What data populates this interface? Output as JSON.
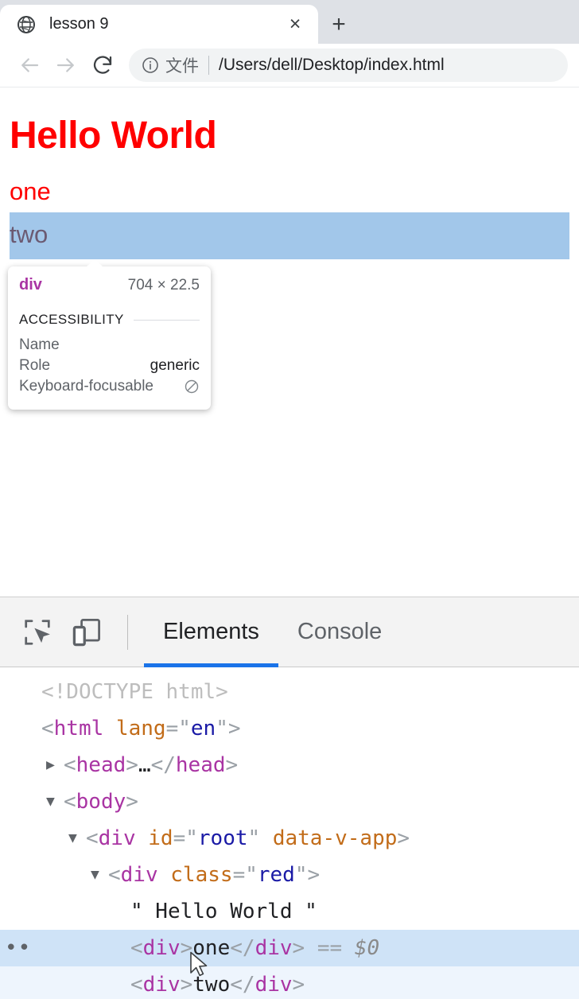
{
  "browser": {
    "tab": {
      "title": "lesson 9",
      "favicon": "globe-icon",
      "close_label": "×"
    },
    "new_tab_label": "+",
    "nav": {
      "back": "←",
      "forward": "→",
      "reload": "↻"
    },
    "omnibox": {
      "info_icon": "info-circle-icon",
      "scheme_label": "文件",
      "url": "/Users/dell/Desktop/index.html"
    }
  },
  "page": {
    "heading": "Hello World",
    "line_one": "one",
    "line_two": "two",
    "heading_color": "#ff0000",
    "highlight_color": "#a2c7ea"
  },
  "inspector_tooltip": {
    "tag": "div",
    "dimensions": "704 × 22.5",
    "section_title": "ACCESSIBILITY",
    "rows": [
      {
        "key": "Name",
        "value": ""
      },
      {
        "key": "Role",
        "value": "generic"
      },
      {
        "key": "Keyboard-focusable",
        "value": "",
        "icon": "not-allowed-icon"
      }
    ]
  },
  "devtools": {
    "toolbar": {
      "inspect_icon": "inspect-element-icon",
      "device_icon": "device-toolbar-icon"
    },
    "tabs": [
      {
        "label": "Elements",
        "active": true
      },
      {
        "label": "Console",
        "active": false
      }
    ],
    "accent_color": "#1a73e8",
    "selected_row_color": "#cfe3f7",
    "hovered_row_color": "#eef5fd",
    "tree": [
      {
        "indent": 0,
        "arrow": "",
        "gutter": "",
        "state": "",
        "tokens": [
          {
            "t": "doctype",
            "s": "<!DOCTYPE html>"
          }
        ]
      },
      {
        "indent": 0,
        "arrow": "",
        "gutter": "",
        "state": "",
        "tokens": [
          {
            "t": "punct",
            "s": "<"
          },
          {
            "t": "tag",
            "s": "html"
          },
          {
            "t": "text",
            "s": " "
          },
          {
            "t": "attr",
            "s": "lang"
          },
          {
            "t": "punct",
            "s": "=\""
          },
          {
            "t": "val",
            "s": "en"
          },
          {
            "t": "punct",
            "s": "\">"
          }
        ]
      },
      {
        "indent": 1,
        "arrow": "▶",
        "gutter": "",
        "state": "",
        "tokens": [
          {
            "t": "punct",
            "s": "<"
          },
          {
            "t": "tag",
            "s": "head"
          },
          {
            "t": "punct",
            "s": ">"
          },
          {
            "t": "text",
            "s": "…"
          },
          {
            "t": "punct",
            "s": "</"
          },
          {
            "t": "tag",
            "s": "head"
          },
          {
            "t": "punct",
            "s": ">"
          }
        ]
      },
      {
        "indent": 1,
        "arrow": "▼",
        "gutter": "",
        "state": "",
        "tokens": [
          {
            "t": "punct",
            "s": "<"
          },
          {
            "t": "tag",
            "s": "body"
          },
          {
            "t": "punct",
            "s": ">"
          }
        ]
      },
      {
        "indent": 2,
        "arrow": "▼",
        "gutter": "",
        "state": "",
        "tokens": [
          {
            "t": "punct",
            "s": "<"
          },
          {
            "t": "tag",
            "s": "div"
          },
          {
            "t": "text",
            "s": " "
          },
          {
            "t": "attr",
            "s": "id"
          },
          {
            "t": "punct",
            "s": "=\""
          },
          {
            "t": "val",
            "s": "root"
          },
          {
            "t": "punct",
            "s": "\""
          },
          {
            "t": "text",
            "s": " "
          },
          {
            "t": "attr",
            "s": "data-v-app"
          },
          {
            "t": "punct",
            "s": ">"
          }
        ]
      },
      {
        "indent": 3,
        "arrow": "▼",
        "gutter": "",
        "state": "",
        "tokens": [
          {
            "t": "punct",
            "s": "<"
          },
          {
            "t": "tag",
            "s": "div"
          },
          {
            "t": "text",
            "s": " "
          },
          {
            "t": "attr",
            "s": "class"
          },
          {
            "t": "punct",
            "s": "=\""
          },
          {
            "t": "val",
            "s": "red"
          },
          {
            "t": "punct",
            "s": "\">"
          }
        ]
      },
      {
        "indent": 4,
        "arrow": "",
        "gutter": "",
        "state": "",
        "tokens": [
          {
            "t": "text",
            "s": "\" Hello World \""
          }
        ]
      },
      {
        "indent": 4,
        "arrow": "",
        "gutter": "••",
        "state": "selected",
        "tokens": [
          {
            "t": "punct",
            "s": "<"
          },
          {
            "t": "tag",
            "s": "div"
          },
          {
            "t": "punct",
            "s": ">"
          },
          {
            "t": "text",
            "s": "one"
          },
          {
            "t": "punct",
            "s": "</"
          },
          {
            "t": "tag",
            "s": "div"
          },
          {
            "t": "punct",
            "s": ">"
          },
          {
            "t": "ref",
            "s": " == "
          },
          {
            "t": "dollar",
            "s": "$0"
          }
        ]
      },
      {
        "indent": 4,
        "arrow": "",
        "gutter": "",
        "state": "hovered",
        "tokens": [
          {
            "t": "punct",
            "s": "<"
          },
          {
            "t": "tag",
            "s": "div"
          },
          {
            "t": "punct",
            "s": ">"
          },
          {
            "t": "text",
            "s": "two"
          },
          {
            "t": "punct",
            "s": "</"
          },
          {
            "t": "tag",
            "s": "div"
          },
          {
            "t": "punct",
            "s": ">"
          }
        ]
      }
    ]
  }
}
